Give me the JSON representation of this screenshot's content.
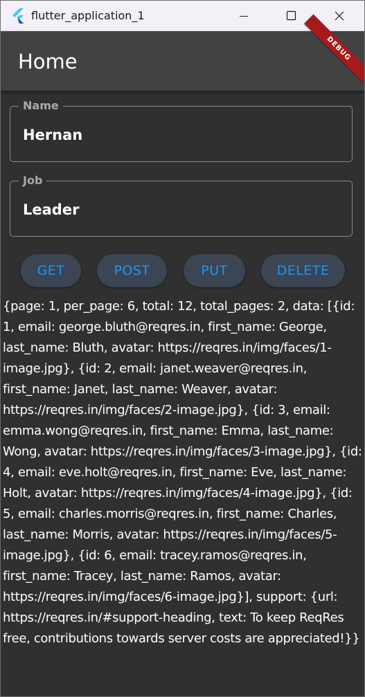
{
  "window": {
    "title": "flutter_application_1",
    "app_icon": "flutter-logo-icon",
    "controls": {
      "minimize_icon": "minimize-icon",
      "maximize_icon": "maximize-icon",
      "close_icon": "close-icon"
    }
  },
  "appbar": {
    "title": "Home",
    "debug_banner": "DEBUG"
  },
  "form": {
    "name": {
      "label": "Name",
      "value": "Hernan"
    },
    "job": {
      "label": "Job",
      "value": "Leader"
    }
  },
  "buttons": {
    "get": "GET",
    "post": "POST",
    "put": "PUT",
    "delete": "DELETE"
  },
  "response_text": "{page: 1, per_page: 6, total: 12, total_pages: 2, data: [{id: 1, email: george.bluth@reqres.in, first_name: George, last_name: Bluth, avatar: https://reqres.in/img/faces/1-image.jpg}, {id: 2, email: janet.weaver@reqres.in, first_name: Janet, last_name: Weaver, avatar: https://reqres.in/img/faces/2-image.jpg}, {id: 3, email: emma.wong@reqres.in, first_name: Emma, last_name: Wong, avatar: https://reqres.in/img/faces/3-image.jpg}, {id: 4, email: eve.holt@reqres.in, first_name: Eve, last_name: Holt, avatar: https://reqres.in/img/faces/4-image.jpg}, {id: 5, email: charles.morris@reqres.in, first_name: Charles, last_name: Morris, avatar: https://reqres.in/img/faces/5-image.jpg}, {id: 6, email: tracey.ramos@reqres.in, first_name: Tracey, last_name: Ramos, avatar: https://reqres.in/img/faces/6-image.jpg}], support: {url: https://reqres.in/#support-heading, text: To keep ReqRes free, contributions towards server costs are appreciated!}}",
  "colors": {
    "titlebar_bg": "#f3f0f8",
    "appbar_bg": "#424242",
    "body_bg": "#303030",
    "button_text": "#2196f3",
    "button_bg": "#3b4553",
    "debug_banner": "#a51b1b",
    "flutter_blue": "#47c5fb"
  }
}
